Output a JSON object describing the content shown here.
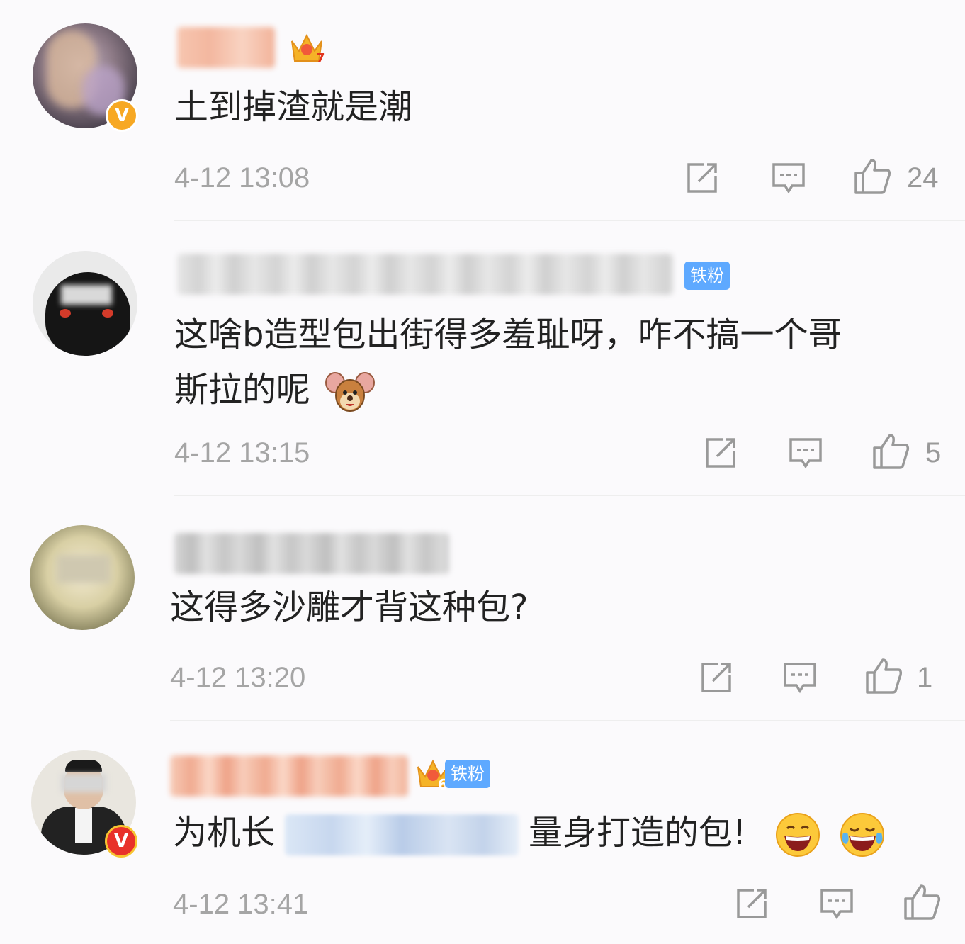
{
  "comments": [
    {
      "text": "土到掉渣就是潮",
      "time": "4-12 13:08",
      "likes": "24",
      "badge": "V",
      "crown_level": "7"
    },
    {
      "text_line1": "这啥b造型包出街得多羞耻呀，咋不搞一个哥",
      "text_line2": "斯拉的呢",
      "tag": "铁粉",
      "time": "4-12 13:15",
      "likes": "5"
    },
    {
      "text": "这得多沙雕才背这种包?",
      "time": "4-12 13:20",
      "likes": "1"
    },
    {
      "text_before": "为机长",
      "text_after": "量身打造的包!",
      "tag": "铁粉",
      "crown_level": "6",
      "badge": "V",
      "time": "4-12 13:41"
    }
  ],
  "icons": {
    "share": "share-icon",
    "comment": "comment-icon",
    "like": "thumbs-up-icon"
  },
  "colors": {
    "tag_blue": "#5ea9ff",
    "badge_orange": "#f7a823",
    "badge_red": "#e8312a",
    "time_gray": "#a5a5a5"
  }
}
